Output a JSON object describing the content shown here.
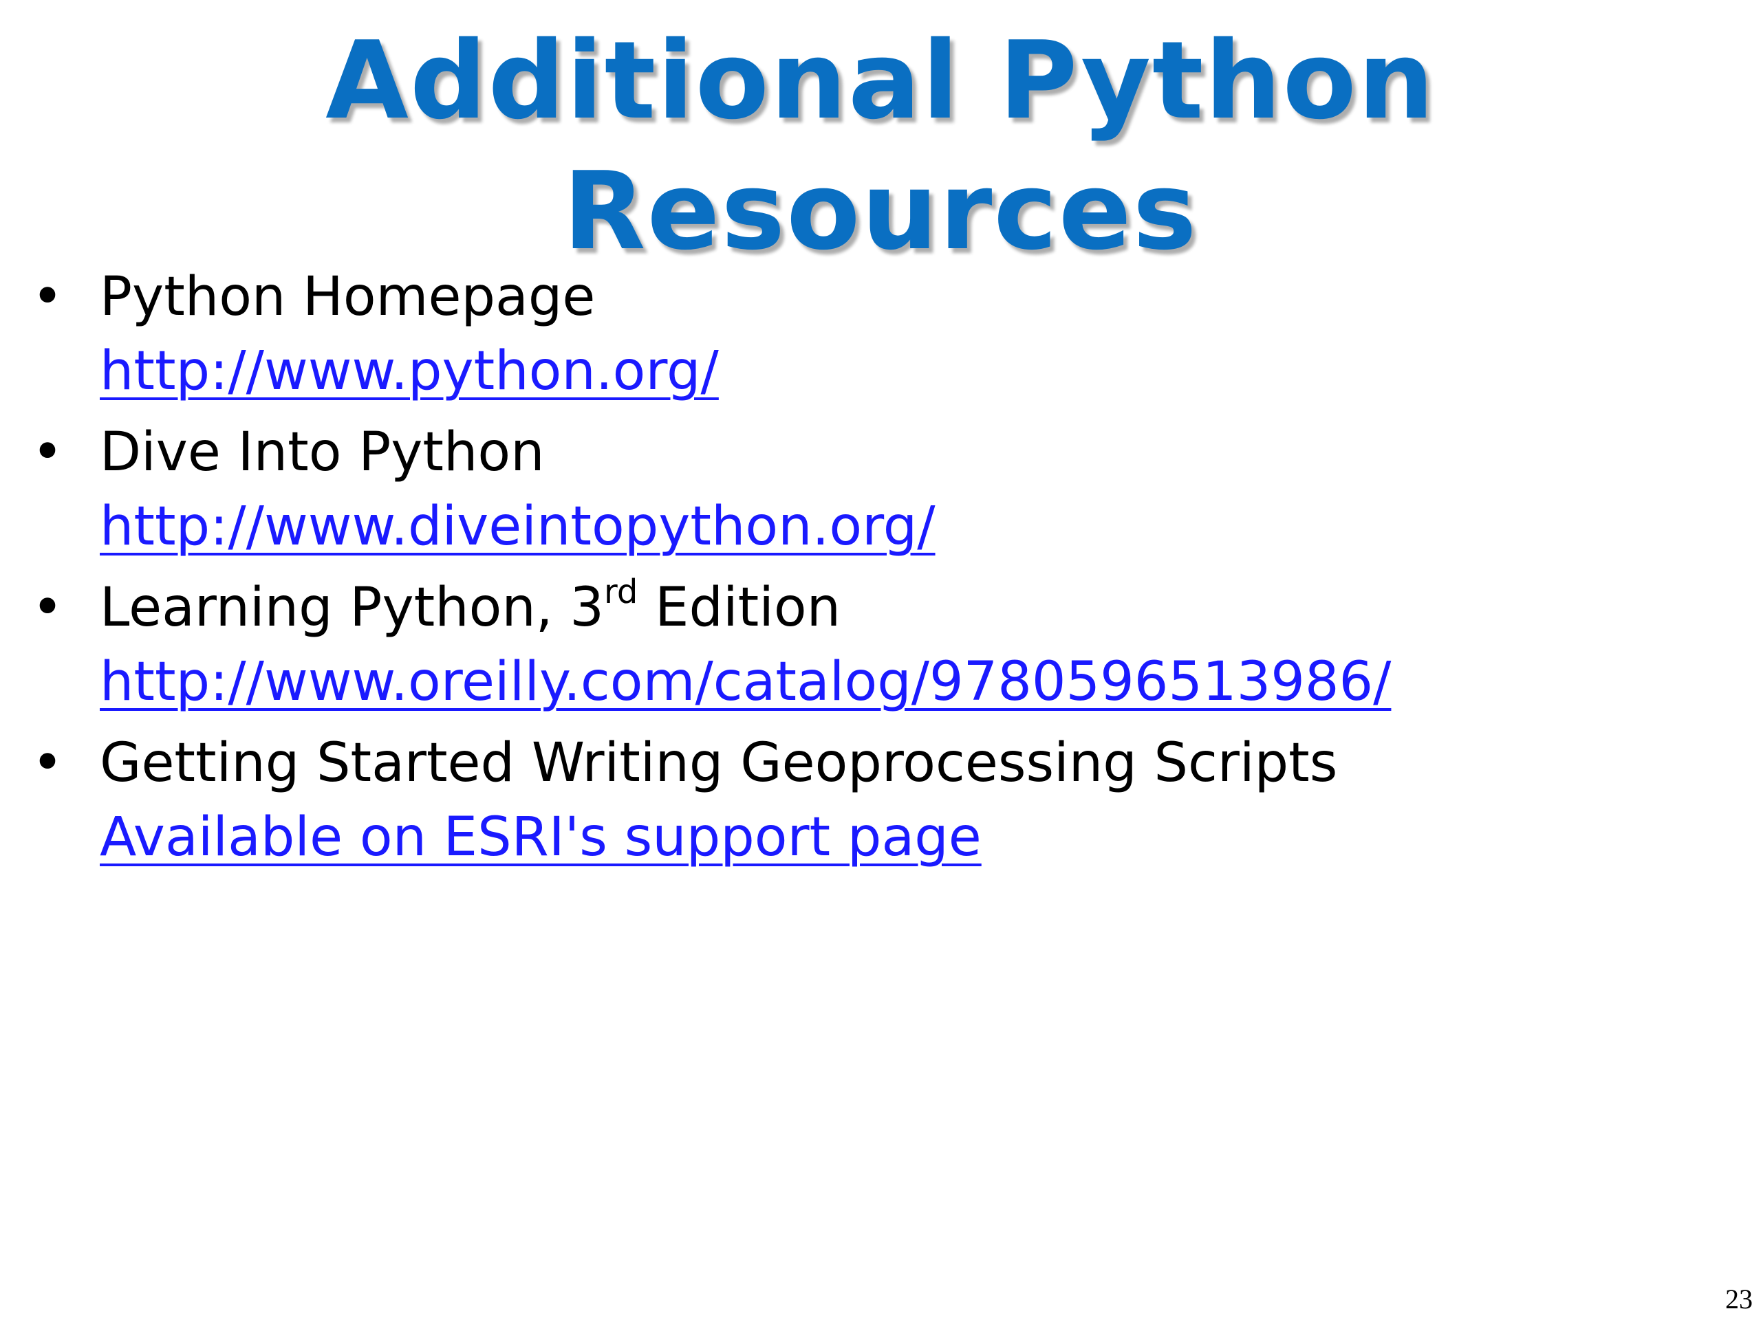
{
  "slide": {
    "title": "Additional Python Resources",
    "page_number": "23",
    "colors": {
      "title": "#0a6fc2",
      "link": "#1a1aff",
      "text": "#000000",
      "background": "#ffffff"
    },
    "items": [
      {
        "title": "Python Homepage",
        "link": "http://www.python.org/"
      },
      {
        "title": "Dive Into Python",
        "link": "http://www.diveintopython.org/"
      },
      {
        "title_prefix": "Learning Python, 3",
        "title_superscript": "rd",
        "title_suffix": " Edition",
        "link": "http://www.oreilly.com/catalog/9780596513986/"
      },
      {
        "title": "Getting Started Writing Geoprocessing Scripts",
        "link": "Available on ESRI's support page"
      }
    ]
  }
}
